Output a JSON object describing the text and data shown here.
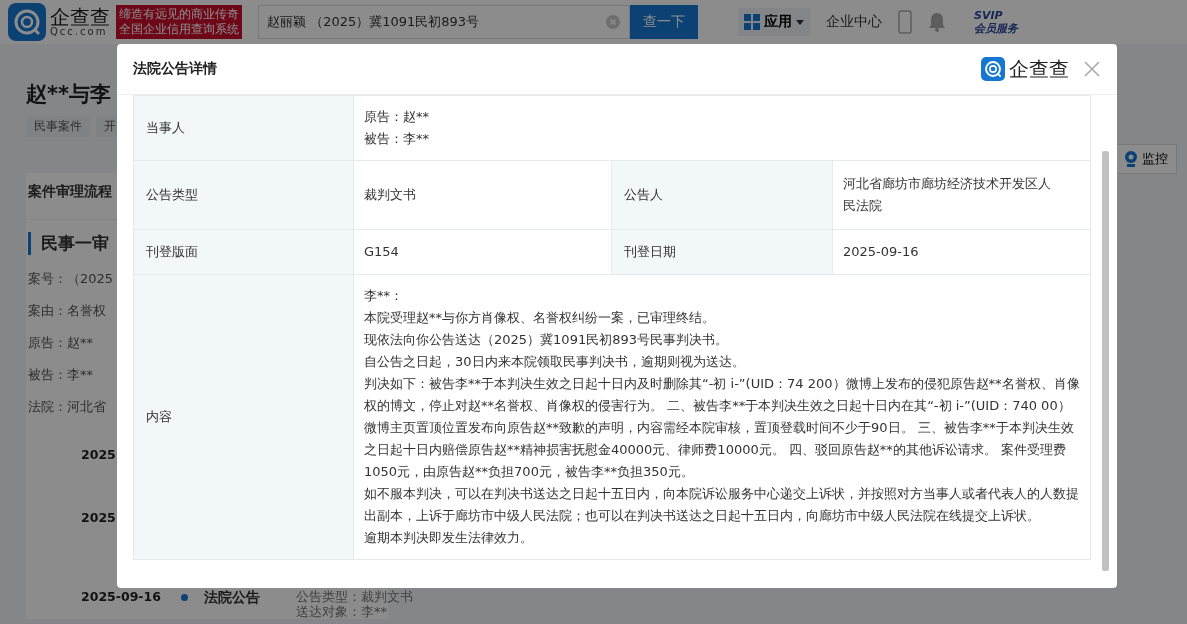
{
  "header": {
    "logo_text": "企查查",
    "logo_sub": "Qcc.com",
    "slogan": [
      "缔造有远见的商业传奇",
      "全国企业信用查询系统"
    ],
    "search": {
      "value": "赵丽颖 （2025）冀1091民初893号"
    },
    "search_button": "查一下",
    "nav": [
      {
        "label": "应用",
        "kind": "menu"
      },
      {
        "label": "企业中心",
        "kind": "link"
      },
      {
        "kind": "phone"
      },
      {
        "kind": "bell"
      }
    ],
    "vip": {
      "badge": "SVIP",
      "label": "会员服务"
    }
  },
  "page": {
    "title": "赵**与李",
    "tags": [
      "民事案件",
      "开"
    ],
    "monitor_button": "监控",
    "section_title": "案件审理流程",
    "stage": "民事一审",
    "fields": [
      "案号：（2025",
      "案由：名誉权",
      "原告：赵**",
      "被告：李**",
      "法院：河北省"
    ],
    "timeline": [
      {
        "date": "2025"
      },
      {
        "date": "2025"
      },
      {
        "date": "2025-09-16",
        "title": "法院公告",
        "details": [
          "公告类型：裁判文书",
          "送达对象：李**"
        ]
      }
    ]
  },
  "dialog": {
    "title": "法院公告详情",
    "brand": "企查查",
    "rows": [
      {
        "cells": [
          {
            "label": "当事人",
            "lines": [
              "原告：赵**",
              "被告：李**"
            ]
          }
        ]
      },
      {
        "cells": [
          {
            "label": "公告类型",
            "lines": [
              "裁判文书"
            ]
          },
          {
            "label": "公告人",
            "lines": [
              "河北省廊坊市廊坊经济技术开发区人民法院"
            ]
          }
        ]
      },
      {
        "cells": [
          {
            "label": "刊登版面",
            "lines": [
              "G154"
            ]
          },
          {
            "label": "刊登日期",
            "lines": [
              "2025-09-16"
            ]
          }
        ]
      },
      {
        "cells": [
          {
            "label": "内容",
            "lines": [
              "李**：",
              "本院受理赵**与你方肖像权、名誉权纠纷一案，已审理终结。",
              "现依法向你公告送达（2025）冀1091民初893号民事判决书。",
              "自公告之日起，30日内来本院领取民事判决书，逾期则视为送达。",
              "判决如下：被告李**于本判决生效之日起十日内及时删除其“-初    i-”(UID：74        200）微博上发布的侵犯原告赵**名誉权、肖像权的博文，停止对赵**名誉权、肖像权的侵害行为。 二、被告李**于本判决生效之日起十日内在其“-初    i-”(UID：740        00）微博主页置顶位置发布向原告赵**致歉的声明，内容需经本院审核，置顶登载时间不少于90日。 三、被告李**于本判决生效之日起十日内赔偿原告赵**精神损害抚慰金40000元、律师费10000元。 四、驳回原告赵**的其他诉讼请求。 案件受理费1050元，由原告赵**负担700元，被告李**负担350元。",
              "如不服本判决，可以在判决书送达之日起十五日内，向本院诉讼服务中心递交上诉状，并按照对方当事人或者代表人的人数提出副本，上诉于廊坊市中级人民法院；也可以在判决书送达之日起十五日内，向廊坊市中级人民法院在线提交上诉状。",
              "逾期本判决即发生法律效力。"
            ]
          }
        ]
      }
    ]
  }
}
